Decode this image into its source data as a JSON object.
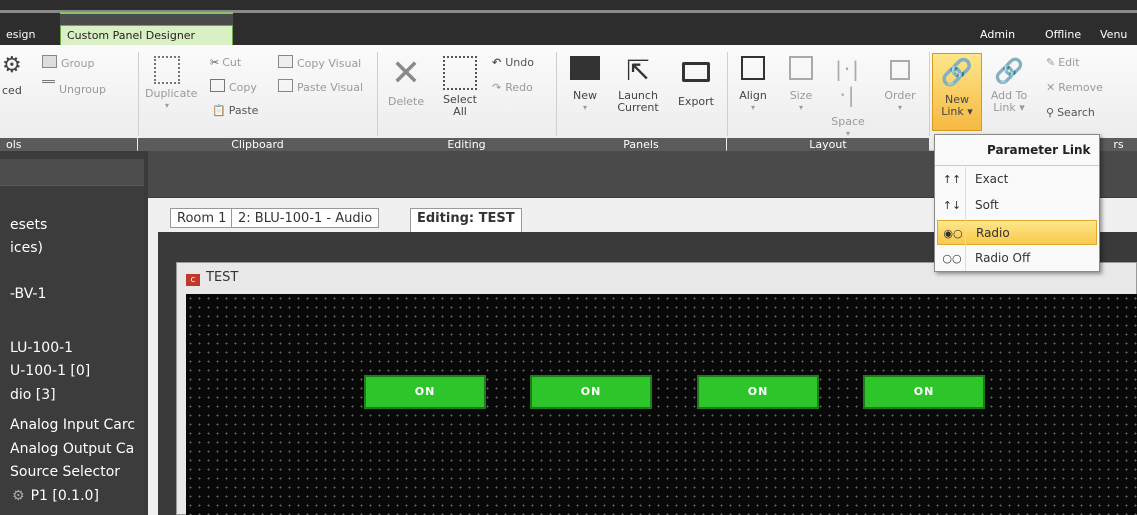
{
  "tabs": [
    {
      "label": "esign"
    },
    {
      "label": "Custom Panel Designer"
    }
  ],
  "header_links": [
    "Admin",
    "Offline",
    "Venu"
  ],
  "ribbon": {
    "tools": {
      "group": "Group",
      "ungroup": "Ungroup",
      "advanced": "ced",
      "label": "ols"
    },
    "clipboard": {
      "label": "Clipboard",
      "duplicate": "Duplicate",
      "cut": "Cut",
      "copy": "Copy",
      "paste": "Paste",
      "copy_visual": "Copy Visual",
      "paste_visual": "Paste Visual"
    },
    "editing": {
      "label": "Editing",
      "delete": "Delete",
      "select_all_1": "Select",
      "select_all_2": "All",
      "undo": "Undo",
      "redo": "Redo"
    },
    "panels": {
      "label": "Panels",
      "new": "New",
      "launch_1": "Launch",
      "launch_2": "Current",
      "export": "Export"
    },
    "layout": {
      "label": "Layout",
      "align": "Align",
      "size": "Size",
      "space": "Space",
      "order": "Order"
    },
    "links": {
      "new_link_1": "New",
      "new_link_2": "Link",
      "add_to_1": "Add To",
      "add_to_2": "Link",
      "edit": "Edit",
      "remove": "Remove",
      "search": "Search",
      "label_tail": "rs"
    }
  },
  "tree": [
    "esets",
    "ices)",
    "-BV-1",
    "LU-100-1",
    "U-100-1 [0]",
    "dio [3]",
    "Analog Input Carc",
    "Analog Output Ca",
    "Source Selector",
    "P1 [0.1.0]"
  ],
  "doc_tabs": [
    "Room 1",
    "2: BLU-100-1 - Audio",
    "Editing: TEST"
  ],
  "panel": {
    "title": "TEST",
    "buttons": [
      "ON",
      "ON",
      "ON",
      "ON"
    ]
  },
  "dropdown": {
    "header": "Parameter Link",
    "items": [
      {
        "label": "Exact",
        "selected": false
      },
      {
        "label": "Soft",
        "selected": false
      },
      {
        "label": "Radio",
        "selected": true
      },
      {
        "label": "Radio Off",
        "selected": false
      }
    ]
  },
  "colors": {
    "accent_green": "#2ec52b",
    "tab_green": "#d9f0c4",
    "highlight": "#f9c94a"
  }
}
